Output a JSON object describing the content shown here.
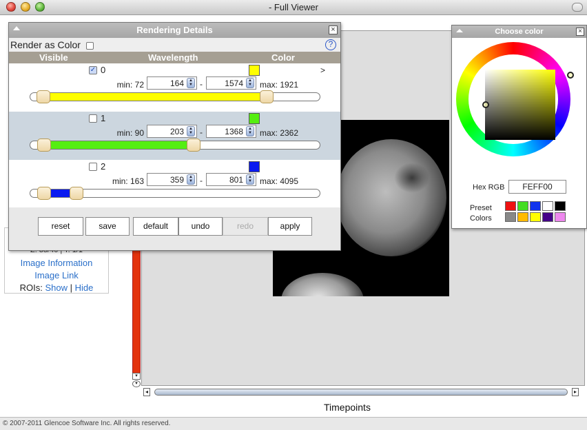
{
  "window": {
    "title": "- Full Viewer"
  },
  "left_panel": {
    "z_line": "Z: 38/40 | T: 1/1",
    "image_info": "Image Information",
    "image_link": "Image Link",
    "rois_label": "ROIs:",
    "rois_show": "Show",
    "rois_sep": "|",
    "rois_hide": "Hide"
  },
  "viewer": {
    "timepoints_label": "Timepoints"
  },
  "footer": {
    "text": "© 2007-2011 Glencoe Software Inc. All rights reserved."
  },
  "render_panel": {
    "title": "Rendering Details",
    "close": "×",
    "render_as_color": "Render as Color",
    "help": "?",
    "columns": {
      "visible": "Visible",
      "wavelength": "Wavelength",
      "color": "Color"
    },
    "more_arrow": ">",
    "channels": [
      {
        "index": "0",
        "checked": true,
        "min_label": "min: 72",
        "start": "164",
        "end": "1574",
        "max_label": "max: 1921",
        "color": "#ffff00",
        "fill_start": 0.047,
        "fill_end": 0.815
      },
      {
        "index": "1",
        "checked": false,
        "min_label": "min: 90",
        "start": "203",
        "end": "1368",
        "max_label": "max: 2362",
        "color": "#55ee11",
        "fill_start": 0.05,
        "fill_end": 0.563
      },
      {
        "index": "2",
        "checked": false,
        "min_label": "min: 163",
        "start": "359",
        "end": "801",
        "max_label": "max: 4095",
        "color": "#0a1af0",
        "fill_start": 0.05,
        "fill_end": 0.162
      }
    ],
    "dash": "-",
    "buttons": {
      "reset": "reset",
      "save": "save",
      "default": "default",
      "undo": "undo",
      "redo": "redo",
      "apply": "apply"
    }
  },
  "color_panel": {
    "title": "Choose color",
    "close": "×",
    "hex_label": "Hex RGB",
    "hex_value": "FEFF00",
    "preset_label_1": "Preset",
    "preset_label_2": "Colors",
    "presets": [
      "#ee1111",
      "#44dd22",
      "#1133ee",
      "#ffffff",
      "#000000",
      "#888888",
      "#ffbb00",
      "#ffff00",
      "#440088",
      "#ee88ee"
    ]
  }
}
